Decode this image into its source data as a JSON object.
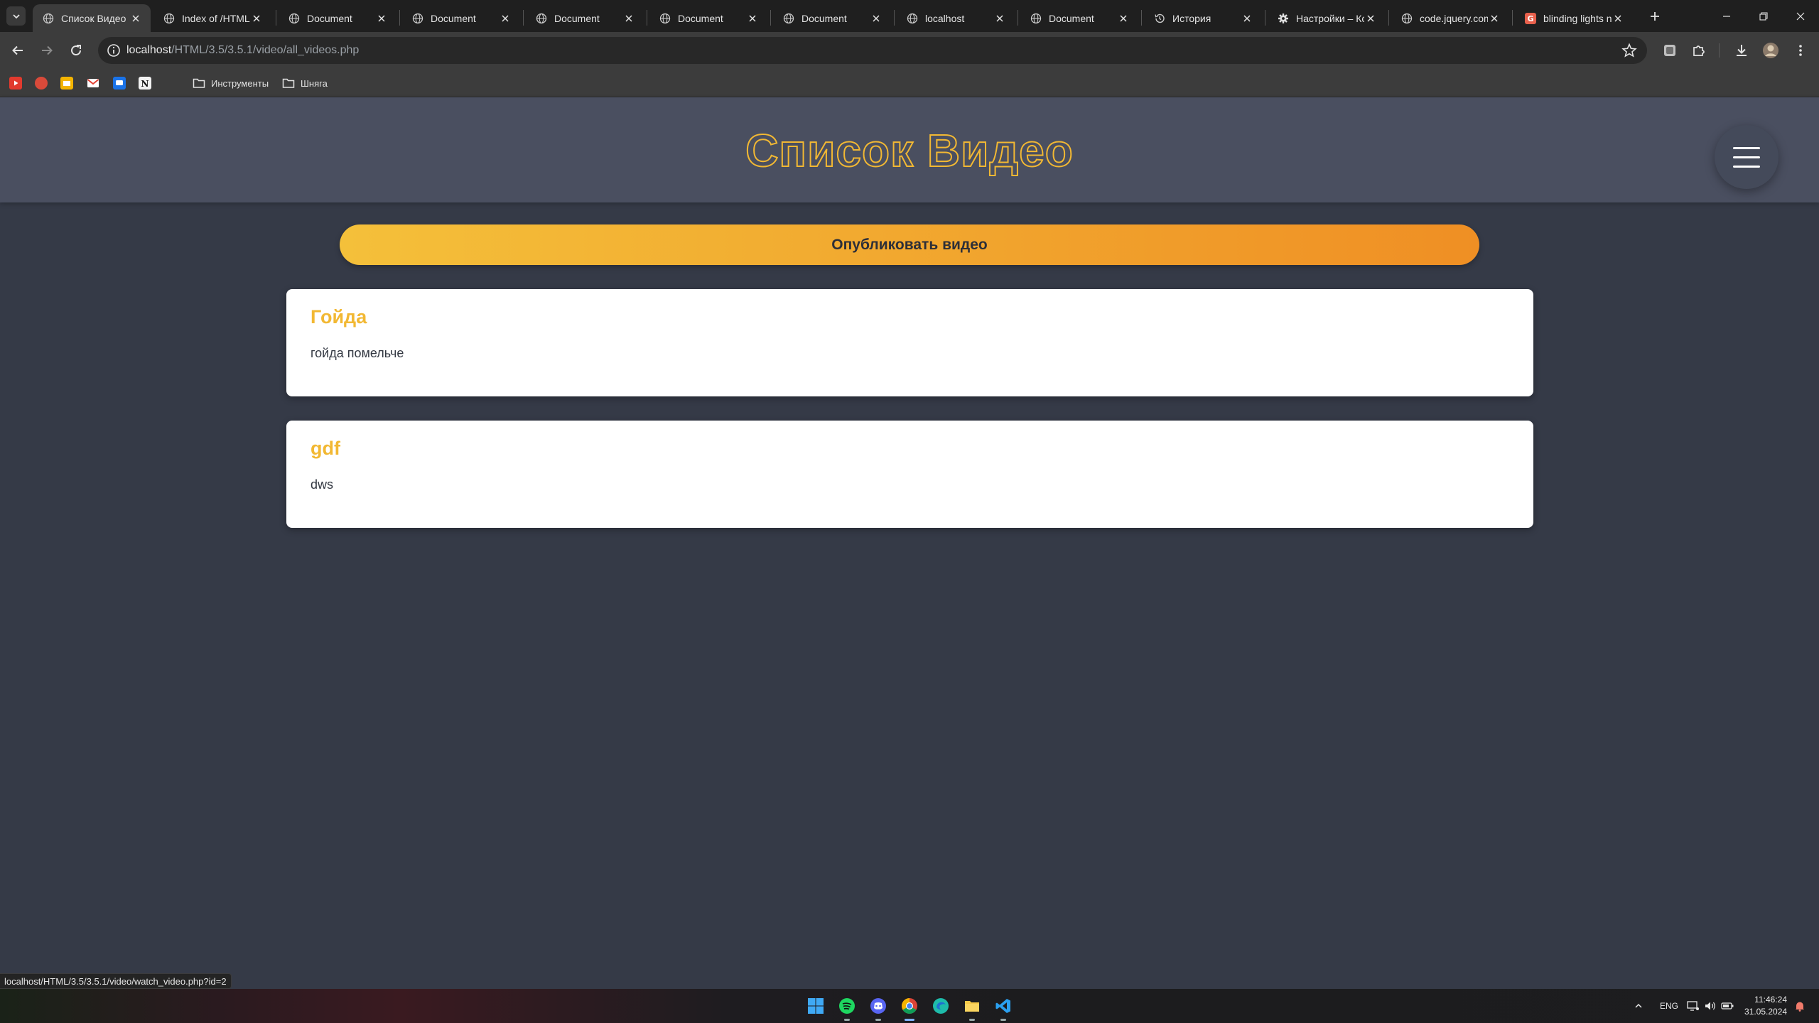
{
  "browser": {
    "tabs": [
      {
        "title": "Список Видео",
        "active": true,
        "favicon": "globe-icon"
      },
      {
        "title": "Index of /HTML",
        "favicon": "globe-icon"
      },
      {
        "title": "Document",
        "favicon": "globe-icon"
      },
      {
        "title": "Document",
        "favicon": "globe-icon"
      },
      {
        "title": "Document",
        "favicon": "globe-icon"
      },
      {
        "title": "Document",
        "favicon": "globe-icon"
      },
      {
        "title": "Document",
        "favicon": "globe-icon"
      },
      {
        "title": "localhost",
        "favicon": "globe-icon"
      },
      {
        "title": "Document",
        "favicon": "globe-icon"
      },
      {
        "title": "История",
        "favicon": "history-icon"
      },
      {
        "title": "Настройки – Ко",
        "favicon": "gear-icon"
      },
      {
        "title": "code.jquery.com",
        "favicon": "globe-icon"
      },
      {
        "title": "blinding lights n",
        "favicon": "genius-icon"
      }
    ],
    "address": {
      "host": "localhost",
      "path": "/HTML/3.5/3.5.1/video/all_videos.php"
    },
    "bookmarks": [
      {
        "label": "Инструменты"
      },
      {
        "label": "Шняга"
      }
    ],
    "status_url": "localhost/HTML/3.5/3.5.1/video/watch_video.php?id=2"
  },
  "page": {
    "title": "Список Видео",
    "publish_button": "Опубликовать видео",
    "videos": [
      {
        "title": "Гойда",
        "description": "гойда помельче"
      },
      {
        "title": "gdf",
        "description": "dws"
      }
    ]
  },
  "taskbar": {
    "language": "ENG",
    "time": "11:46:24",
    "date": "31.05.2024"
  },
  "colors": {
    "accent": "#f2b833",
    "header_bg": "#4a4f60",
    "page_bg": "#353a47",
    "button_gradient_start": "#f4c03a",
    "button_gradient_end": "#ef8f24"
  }
}
